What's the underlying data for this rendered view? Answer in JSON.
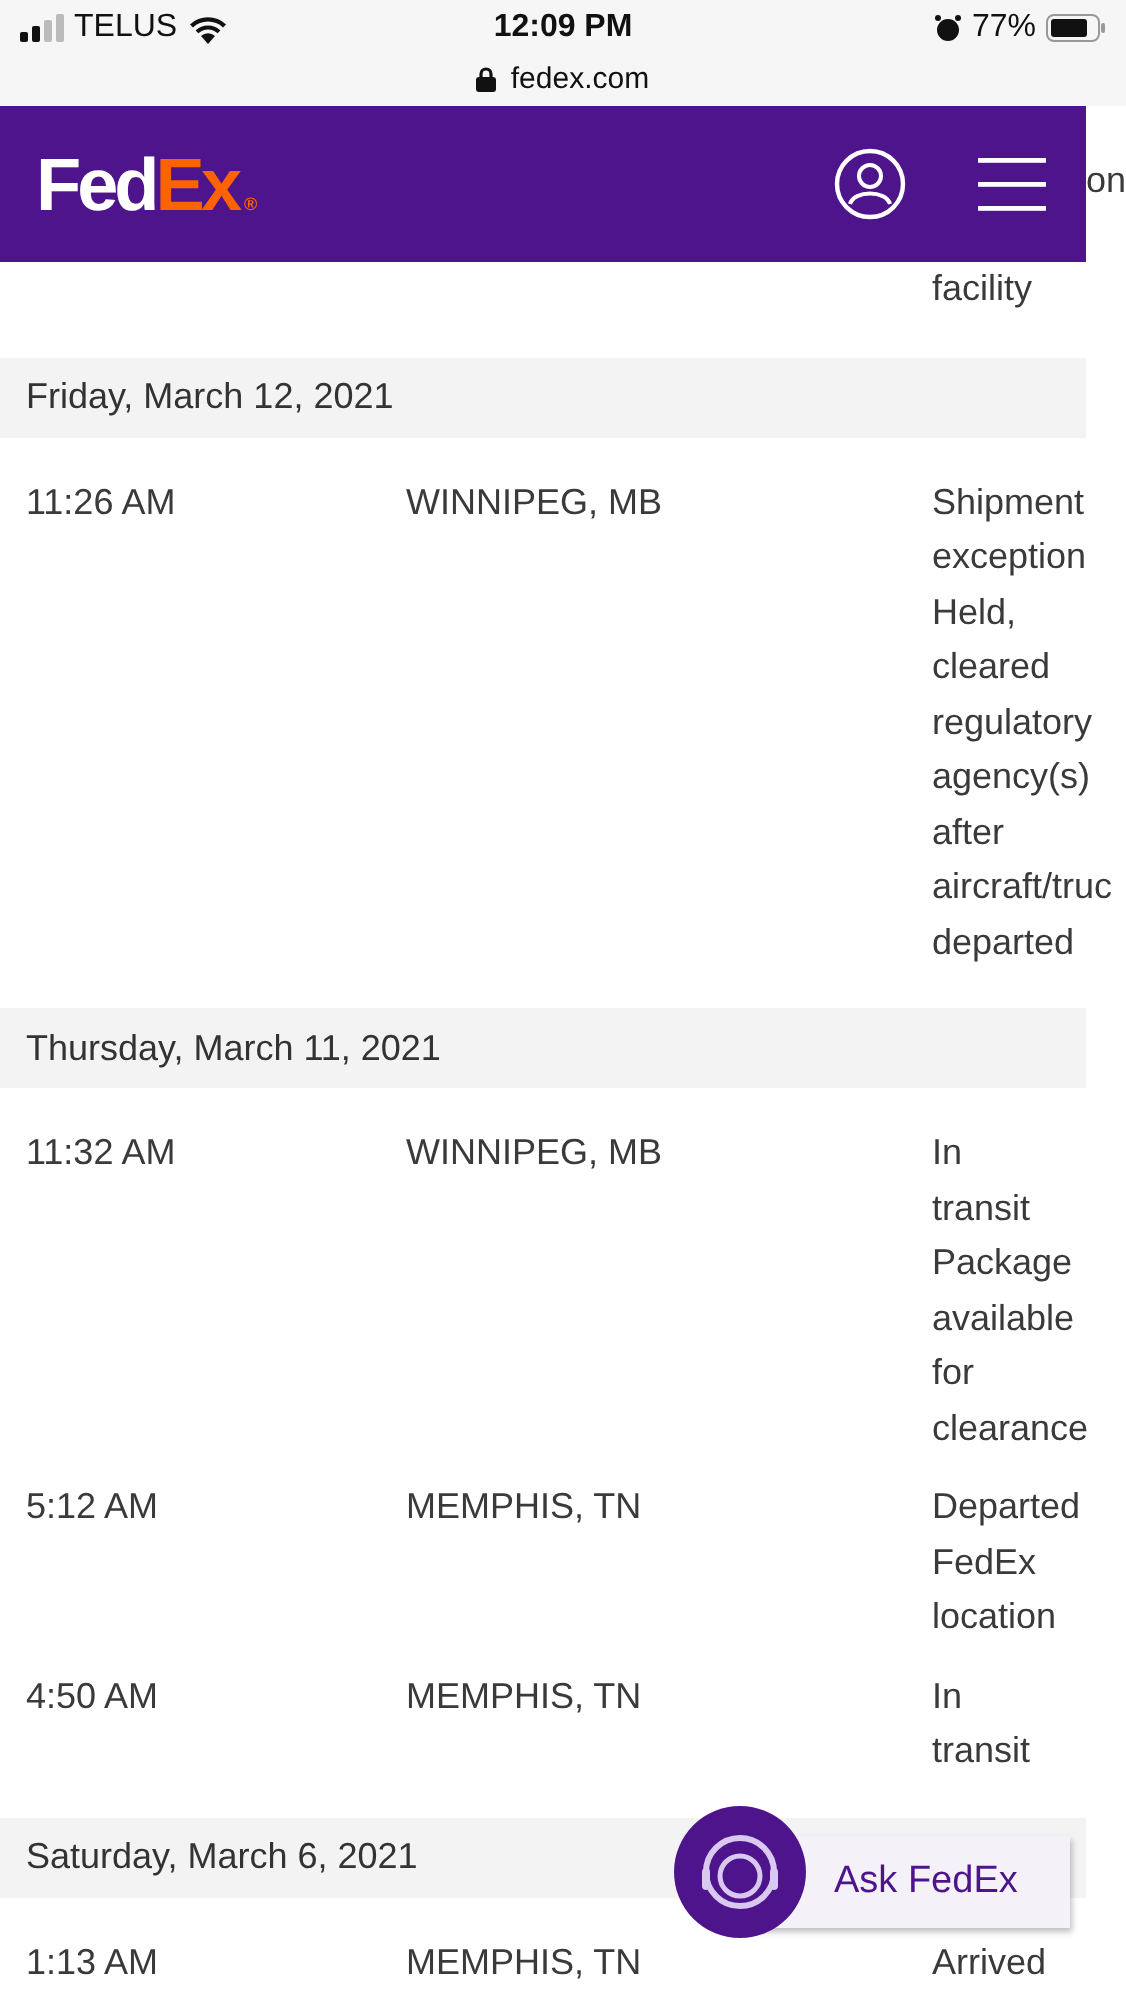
{
  "status_bar": {
    "carrier": "TELUS",
    "time": "12:09 PM",
    "battery": "77%"
  },
  "address_bar": {
    "url": "fedex.com"
  },
  "header": {
    "logo": {
      "fed": "Fed",
      "ex": "Ex",
      "mark": "®"
    }
  },
  "partial_row": {
    "status_lines": [
      "on",
      "facility"
    ]
  },
  "sections": [
    {
      "date": "Friday, March 12, 2021",
      "rows": [
        {
          "time": "11:26 AM",
          "location": "WINNIPEG, MB",
          "status_lines": [
            "Shipment",
            "exception",
            "Held,",
            "cleared",
            "regulatory",
            "agency(s)",
            "after",
            "aircraft/truc",
            "departed"
          ]
        }
      ]
    },
    {
      "date": "Thursday, March 11, 2021",
      "rows": [
        {
          "time": "11:32 AM",
          "location": "WINNIPEG, MB",
          "status_lines": [
            "In",
            "transit",
            "Package",
            "available",
            "for",
            "clearance"
          ]
        },
        {
          "time": "5:12 AM",
          "location": "MEMPHIS, TN",
          "status_lines": [
            "Departed",
            "FedEx",
            "location"
          ]
        },
        {
          "time": "4:50 AM",
          "location": "MEMPHIS, TN",
          "status_lines": [
            "In",
            "transit"
          ]
        }
      ]
    },
    {
      "date": "Saturday, March 6, 2021",
      "rows": [
        {
          "time": "1:13 AM",
          "location": "MEMPHIS, TN",
          "status_lines": [
            "Arrived"
          ]
        }
      ]
    }
  ],
  "chat_button": {
    "label": "Ask FedEx"
  }
}
